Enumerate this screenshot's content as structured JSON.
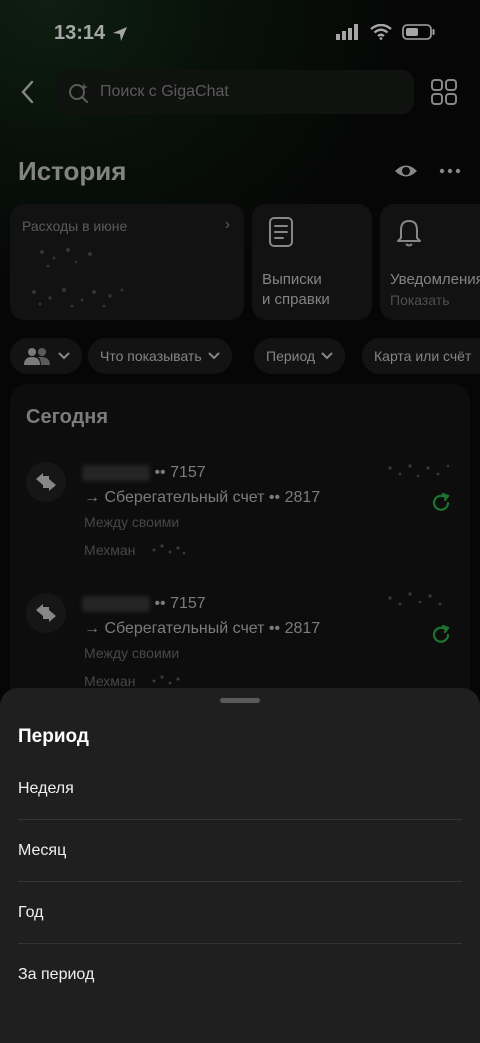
{
  "status_bar": {
    "time": "13:14"
  },
  "header": {
    "search_placeholder": "Поиск с GigaChat",
    "title": "История"
  },
  "cards": [
    {
      "label": "Расходы в июне"
    },
    {
      "line1": "Выписки",
      "line2": "и справки"
    },
    {
      "line1": "Уведомления",
      "line2": "Показать"
    }
  ],
  "filters": [
    {
      "label": "Что показывать"
    },
    {
      "label": "Период"
    },
    {
      "label": "Карта или счёт"
    }
  ],
  "transactions_section": {
    "title": "Сегодня",
    "items": [
      {
        "from_suffix": "•• 7157",
        "to": "→ Сберегательный счет •• 2817",
        "category": "Между своими",
        "person": "Мехман"
      },
      {
        "from_suffix": "•• 7157",
        "to": "→ Сберегательный счет •• 2817",
        "category": "Между своими",
        "person": "Мехман"
      }
    ]
  },
  "sheet": {
    "title": "Период",
    "options": [
      "Неделя",
      "Месяц",
      "Год",
      "За период"
    ]
  },
  "colors": {
    "accent_green": "#2db34a",
    "sheet_bg": "#1f1f1f"
  }
}
